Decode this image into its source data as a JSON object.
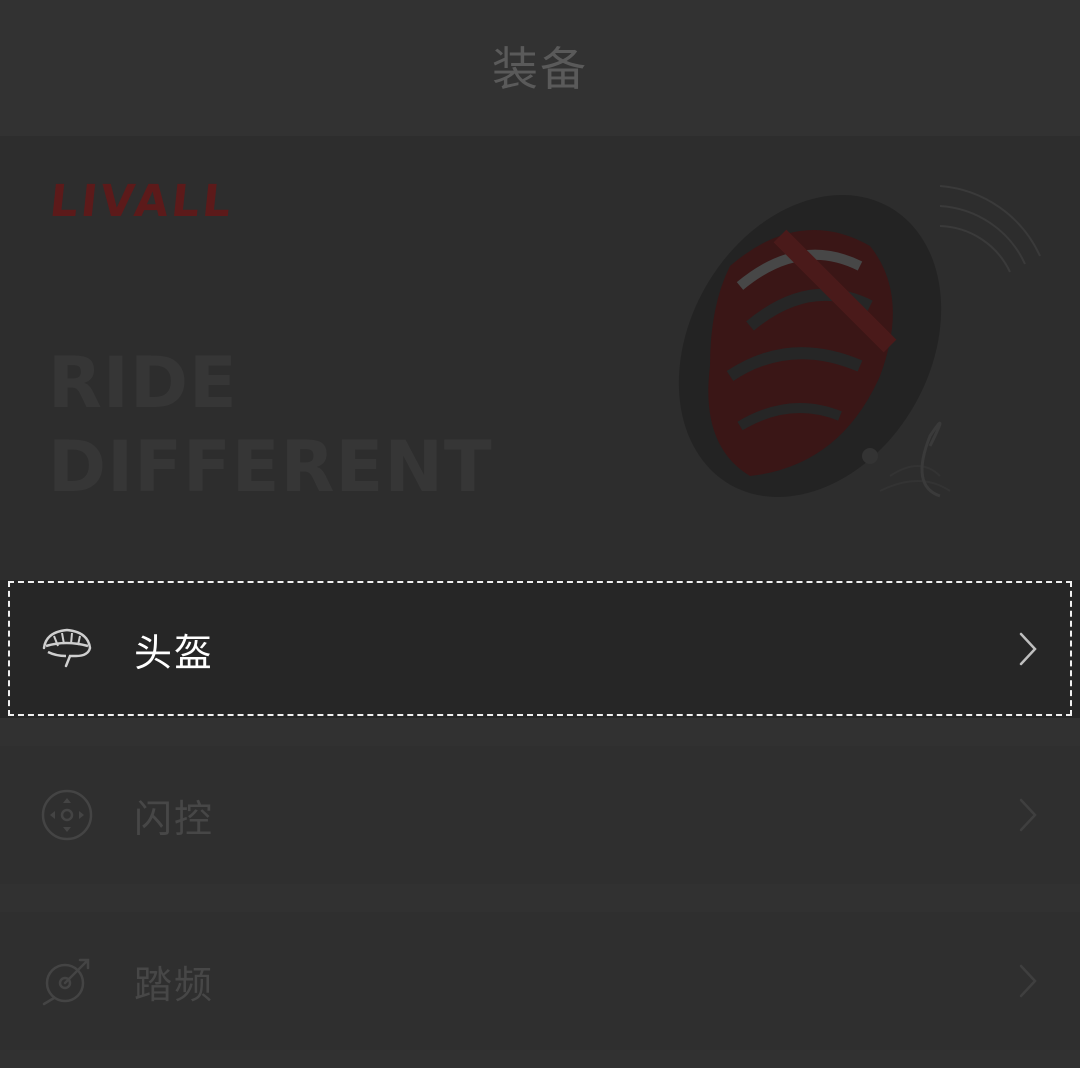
{
  "header": {
    "title": "装备"
  },
  "banner": {
    "brand": "LIVALL",
    "slogan_line1": "RIDE",
    "slogan_line2": "DIFFERENT",
    "brand_color": "#5c1a1a"
  },
  "devices": [
    {
      "label": "头盔",
      "icon": "helmet-icon"
    },
    {
      "label": "闪控",
      "icon": "remote-control-icon"
    },
    {
      "label": "踏频",
      "icon": "cadence-sensor-icon"
    }
  ],
  "colors": {
    "background": "#2f2f2f",
    "selected_row": "#262626",
    "selected_text": "#ffffff",
    "dim_text": "#474747"
  }
}
